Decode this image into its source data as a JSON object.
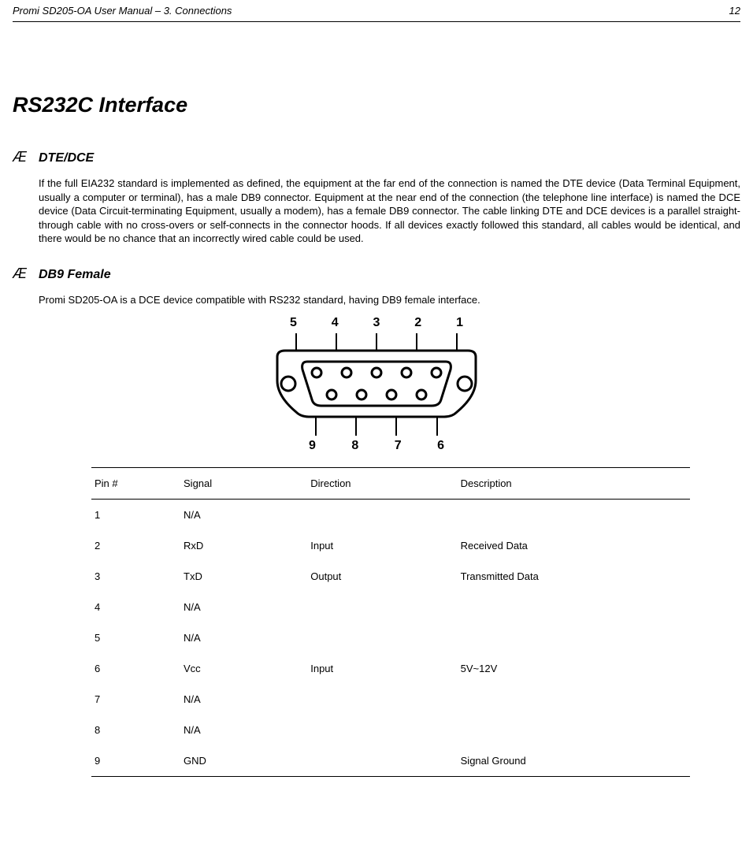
{
  "header": {
    "left": "Promi SD205-OA User Manual – 3. Connections",
    "page": "12"
  },
  "title": "RS232C Interface",
  "bullet_glyph": "Æ",
  "sections": {
    "dte_dce": {
      "heading": "DTE/DCE",
      "body": "If the full EIA232 standard is implemented as defined, the equipment at the far end of the connection is named the DTE device (Data Terminal Equipment, usually a computer or terminal), has a male DB9 connector. Equipment at the near end of the connection (the telephone line interface) is named the DCE device (Data Circuit-terminating Equipment, usually a modem), has a female DB9 connector. The cable linking DTE and DCE devices is a parallel straight-through cable with no cross-overs or self-connects in the connector hoods. If all devices exactly followed this standard, all cables would be identical, and there would be no chance that an incorrectly wired cable could be used."
    },
    "db9": {
      "heading": "DB9 Female",
      "body": "Promi SD205-OA is a DCE device compatible with RS232 standard, having DB9 female interface."
    }
  },
  "diagram": {
    "top_pins": [
      "5",
      "4",
      "3",
      "2",
      "1"
    ],
    "bottom_pins": [
      "9",
      "8",
      "7",
      "6"
    ]
  },
  "pin_table": {
    "headers": {
      "pin": "Pin #",
      "signal": "Signal",
      "direction": "Direction",
      "description": "Description"
    },
    "rows": [
      {
        "pin": "1",
        "signal": "N/A",
        "direction": "",
        "description": ""
      },
      {
        "pin": "2",
        "signal": "RxD",
        "direction": "Input",
        "description": "Received Data"
      },
      {
        "pin": "3",
        "signal": "TxD",
        "direction": "Output",
        "description": "Transmitted Data"
      },
      {
        "pin": "4",
        "signal": "N/A",
        "direction": "",
        "description": ""
      },
      {
        "pin": "5",
        "signal": "N/A",
        "direction": "",
        "description": ""
      },
      {
        "pin": "6",
        "signal": "Vcc",
        "direction": "Input",
        "description": "5V~12V"
      },
      {
        "pin": "7",
        "signal": "N/A",
        "direction": "",
        "description": ""
      },
      {
        "pin": "8",
        "signal": "N/A",
        "direction": "",
        "description": ""
      },
      {
        "pin": "9",
        "signal": "GND",
        "direction": "",
        "description": "Signal Ground"
      }
    ]
  }
}
